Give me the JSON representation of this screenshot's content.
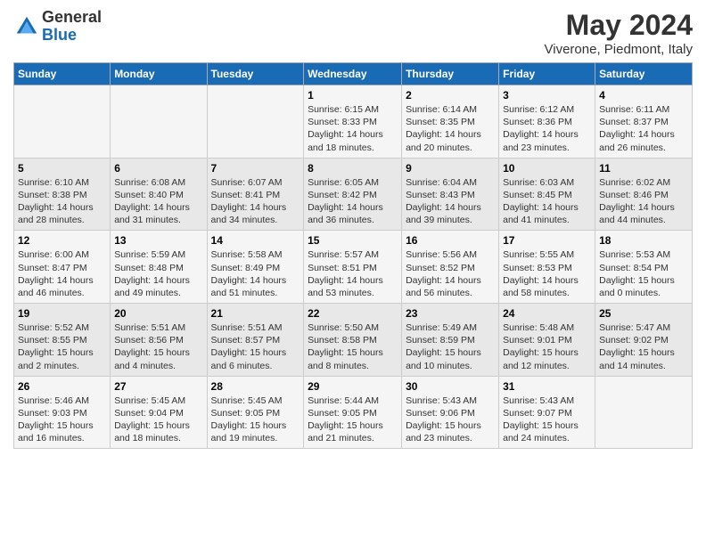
{
  "logo": {
    "general": "General",
    "blue": "Blue"
  },
  "title": "May 2024",
  "subtitle": "Viverone, Piedmont, Italy",
  "days_of_week": [
    "Sunday",
    "Monday",
    "Tuesday",
    "Wednesday",
    "Thursday",
    "Friday",
    "Saturday"
  ],
  "weeks": [
    [
      {
        "day": "",
        "info": ""
      },
      {
        "day": "",
        "info": ""
      },
      {
        "day": "",
        "info": ""
      },
      {
        "day": "1",
        "info": "Sunrise: 6:15 AM\nSunset: 8:33 PM\nDaylight: 14 hours\nand 18 minutes."
      },
      {
        "day": "2",
        "info": "Sunrise: 6:14 AM\nSunset: 8:35 PM\nDaylight: 14 hours\nand 20 minutes."
      },
      {
        "day": "3",
        "info": "Sunrise: 6:12 AM\nSunset: 8:36 PM\nDaylight: 14 hours\nand 23 minutes."
      },
      {
        "day": "4",
        "info": "Sunrise: 6:11 AM\nSunset: 8:37 PM\nDaylight: 14 hours\nand 26 minutes."
      }
    ],
    [
      {
        "day": "5",
        "info": "Sunrise: 6:10 AM\nSunset: 8:38 PM\nDaylight: 14 hours\nand 28 minutes."
      },
      {
        "day": "6",
        "info": "Sunrise: 6:08 AM\nSunset: 8:40 PM\nDaylight: 14 hours\nand 31 minutes."
      },
      {
        "day": "7",
        "info": "Sunrise: 6:07 AM\nSunset: 8:41 PM\nDaylight: 14 hours\nand 34 minutes."
      },
      {
        "day": "8",
        "info": "Sunrise: 6:05 AM\nSunset: 8:42 PM\nDaylight: 14 hours\nand 36 minutes."
      },
      {
        "day": "9",
        "info": "Sunrise: 6:04 AM\nSunset: 8:43 PM\nDaylight: 14 hours\nand 39 minutes."
      },
      {
        "day": "10",
        "info": "Sunrise: 6:03 AM\nSunset: 8:45 PM\nDaylight: 14 hours\nand 41 minutes."
      },
      {
        "day": "11",
        "info": "Sunrise: 6:02 AM\nSunset: 8:46 PM\nDaylight: 14 hours\nand 44 minutes."
      }
    ],
    [
      {
        "day": "12",
        "info": "Sunrise: 6:00 AM\nSunset: 8:47 PM\nDaylight: 14 hours\nand 46 minutes."
      },
      {
        "day": "13",
        "info": "Sunrise: 5:59 AM\nSunset: 8:48 PM\nDaylight: 14 hours\nand 49 minutes."
      },
      {
        "day": "14",
        "info": "Sunrise: 5:58 AM\nSunset: 8:49 PM\nDaylight: 14 hours\nand 51 minutes."
      },
      {
        "day": "15",
        "info": "Sunrise: 5:57 AM\nSunset: 8:51 PM\nDaylight: 14 hours\nand 53 minutes."
      },
      {
        "day": "16",
        "info": "Sunrise: 5:56 AM\nSunset: 8:52 PM\nDaylight: 14 hours\nand 56 minutes."
      },
      {
        "day": "17",
        "info": "Sunrise: 5:55 AM\nSunset: 8:53 PM\nDaylight: 14 hours\nand 58 minutes."
      },
      {
        "day": "18",
        "info": "Sunrise: 5:53 AM\nSunset: 8:54 PM\nDaylight: 15 hours\nand 0 minutes."
      }
    ],
    [
      {
        "day": "19",
        "info": "Sunrise: 5:52 AM\nSunset: 8:55 PM\nDaylight: 15 hours\nand 2 minutes."
      },
      {
        "day": "20",
        "info": "Sunrise: 5:51 AM\nSunset: 8:56 PM\nDaylight: 15 hours\nand 4 minutes."
      },
      {
        "day": "21",
        "info": "Sunrise: 5:51 AM\nSunset: 8:57 PM\nDaylight: 15 hours\nand 6 minutes."
      },
      {
        "day": "22",
        "info": "Sunrise: 5:50 AM\nSunset: 8:58 PM\nDaylight: 15 hours\nand 8 minutes."
      },
      {
        "day": "23",
        "info": "Sunrise: 5:49 AM\nSunset: 8:59 PM\nDaylight: 15 hours\nand 10 minutes."
      },
      {
        "day": "24",
        "info": "Sunrise: 5:48 AM\nSunset: 9:01 PM\nDaylight: 15 hours\nand 12 minutes."
      },
      {
        "day": "25",
        "info": "Sunrise: 5:47 AM\nSunset: 9:02 PM\nDaylight: 15 hours\nand 14 minutes."
      }
    ],
    [
      {
        "day": "26",
        "info": "Sunrise: 5:46 AM\nSunset: 9:03 PM\nDaylight: 15 hours\nand 16 minutes."
      },
      {
        "day": "27",
        "info": "Sunrise: 5:45 AM\nSunset: 9:04 PM\nDaylight: 15 hours\nand 18 minutes."
      },
      {
        "day": "28",
        "info": "Sunrise: 5:45 AM\nSunset: 9:05 PM\nDaylight: 15 hours\nand 19 minutes."
      },
      {
        "day": "29",
        "info": "Sunrise: 5:44 AM\nSunset: 9:05 PM\nDaylight: 15 hours\nand 21 minutes."
      },
      {
        "day": "30",
        "info": "Sunrise: 5:43 AM\nSunset: 9:06 PM\nDaylight: 15 hours\nand 23 minutes."
      },
      {
        "day": "31",
        "info": "Sunrise: 5:43 AM\nSunset: 9:07 PM\nDaylight: 15 hours\nand 24 minutes."
      },
      {
        "day": "",
        "info": ""
      }
    ]
  ]
}
